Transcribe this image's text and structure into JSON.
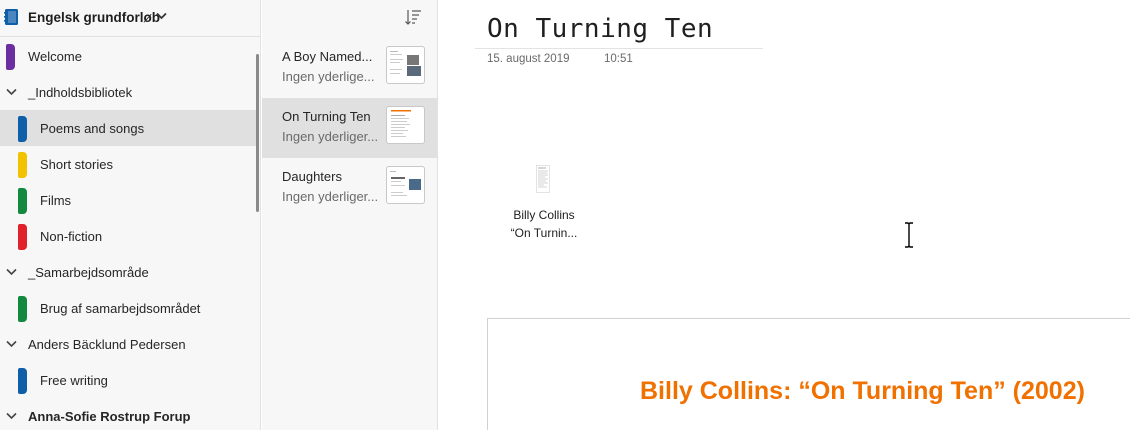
{
  "notebook": {
    "name": "Engelsk grundforløb",
    "color": "#0f5ea8"
  },
  "sections": [
    {
      "type": "section",
      "label": "Welcome",
      "color": "#6a2ea0"
    },
    {
      "type": "group",
      "label": "_Indholdsbibliotek"
    },
    {
      "type": "section",
      "label": "Poems and songs",
      "color": "#0f5ea8",
      "selected": true
    },
    {
      "type": "section",
      "label": "Short stories",
      "color": "#f2c100"
    },
    {
      "type": "section",
      "label": "Films",
      "color": "#12893e"
    },
    {
      "type": "section",
      "label": "Non-fiction",
      "color": "#e0212a"
    },
    {
      "type": "group",
      "label": "_Samarbejdsområde"
    },
    {
      "type": "section",
      "label": "Brug af samarbejdsområdet",
      "color": "#12893e"
    },
    {
      "type": "group",
      "label": "Anders Bäcklund Pedersen"
    },
    {
      "type": "section",
      "label": "Free writing",
      "color": "#0f5ea8"
    },
    {
      "type": "group",
      "label": "Anna-Sofie Rostrup Forup",
      "bold": true
    }
  ],
  "pages": [
    {
      "title": "A Boy Named...",
      "subtitle": "Ingen yderlige...",
      "selected": false
    },
    {
      "title": "On Turning Ten",
      "subtitle": "Ingen yderliger...",
      "selected": true
    },
    {
      "title": "Daughters",
      "subtitle": "Ingen yderliger...",
      "selected": false
    }
  ],
  "page": {
    "title": "On Turning Ten",
    "date": "15. august 2019",
    "time": "10:51",
    "attachment_line1": "Billy Collins",
    "attachment_line2": "“On Turnin...",
    "printout_title": "Billy Collins: “On Turning Ten” (2002)",
    "accent": "#f07000"
  },
  "icons": {
    "notebook": "notebook-icon",
    "chevron": "chevron-down-icon",
    "sort": "sort-icon",
    "attachment": "file-icon",
    "cursor": "text-cursor-icon"
  }
}
